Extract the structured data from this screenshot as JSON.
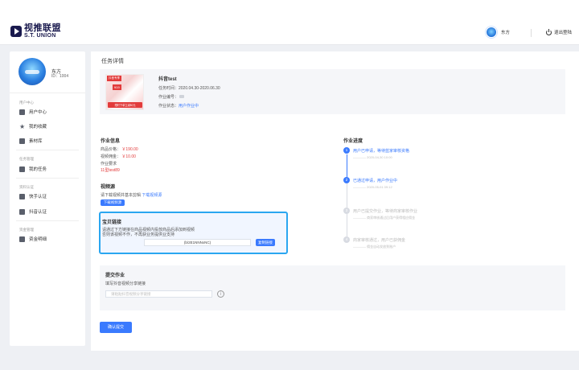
{
  "header": {
    "logo_cn": "视推联盟",
    "logo_en": "S.T. UNION",
    "user_name": "东方",
    "logout_label": "退出登陆"
  },
  "sidebar": {
    "profile": {
      "name": "东方",
      "id": "ID：1004"
    },
    "groups": [
      {
        "label": "用户中心",
        "items": [
          {
            "label": "用户中心",
            "icon": "wallet-icon"
          },
          {
            "label": "我的收藏",
            "icon": "star-icon"
          },
          {
            "label": "素材库",
            "icon": "image-icon"
          }
        ]
      },
      {
        "label": "任务管理",
        "items": [
          {
            "label": "我的任务",
            "icon": "task-icon"
          }
        ]
      },
      {
        "label": "资料认证",
        "items": [
          {
            "label": "快手认证",
            "icon": "camera-icon"
          },
          {
            "label": "抖音认证",
            "icon": "music-note-icon"
          }
        ]
      },
      {
        "label": "资金管理",
        "items": [
          {
            "label": "资金明细",
            "icon": "ledger-icon"
          }
        ]
      }
    ]
  },
  "main": {
    "title": "任务详情",
    "task": {
      "thumb_tag": "抖音专享",
      "thumb_price": "¥19",
      "thumb_footer": "限时下单立减80元",
      "name": "抖音test",
      "time": "任务时间：2020.04.30-2020.06.30",
      "number": "作业编号：",
      "status_label": "作业状态：",
      "status_value": "用户作业中"
    },
    "job_info": {
      "title": "作业信息",
      "price_label": "商品价格：",
      "price_value": "￥190.00",
      "commission_label": "视频佣金：",
      "commission_value": "￥10.00",
      "req_label": "作业要求",
      "req_value": "11型test89"
    },
    "video_link": {
      "title": "视频源",
      "desc": "请下载视频并基本剪辑",
      "link": "下载视频源",
      "button": "下载视频源"
    },
    "taobao": {
      "title": "宝贝链接",
      "desc1": "请通过下方链接在商品视频内投放商品后添加到视频",
      "desc2": "否则该视频不作，不再获业务提供业支持",
      "code": "(b/2E1NNNxNC)",
      "copy_btn": "复制链接"
    },
    "progress": {
      "title": "作业进度",
      "steps": [
        {
          "text": "用户已申请，等待蓝家审核资格",
          "sub": "———— 2020-04-30 10:00",
          "state": "done"
        },
        {
          "text": "已通过申请，用户作业中",
          "sub": "———— 2020-05-01 09:12",
          "state": "current"
        },
        {
          "text": "用户已提交作业，等待商家审核作业",
          "sub": "———— 商家审核通过后用户获得相应佣金",
          "state": "pending"
        },
        {
          "text": "商家审核通过，用户已获佣金",
          "sub": "———— 佣金自动发放到账户",
          "state": "pending"
        }
      ]
    },
    "submit": {
      "title": "提交作业",
      "subtitle": "填写抖音视频分享链接",
      "placeholder": "请粘贴抖音视频分享链接",
      "info_icon": "info-icon"
    },
    "confirm_btn": "确认提交"
  },
  "colors": {
    "accent": "#3a7afe",
    "highlight_border": "#2aa6f0",
    "price_red": "#e23b3b"
  }
}
